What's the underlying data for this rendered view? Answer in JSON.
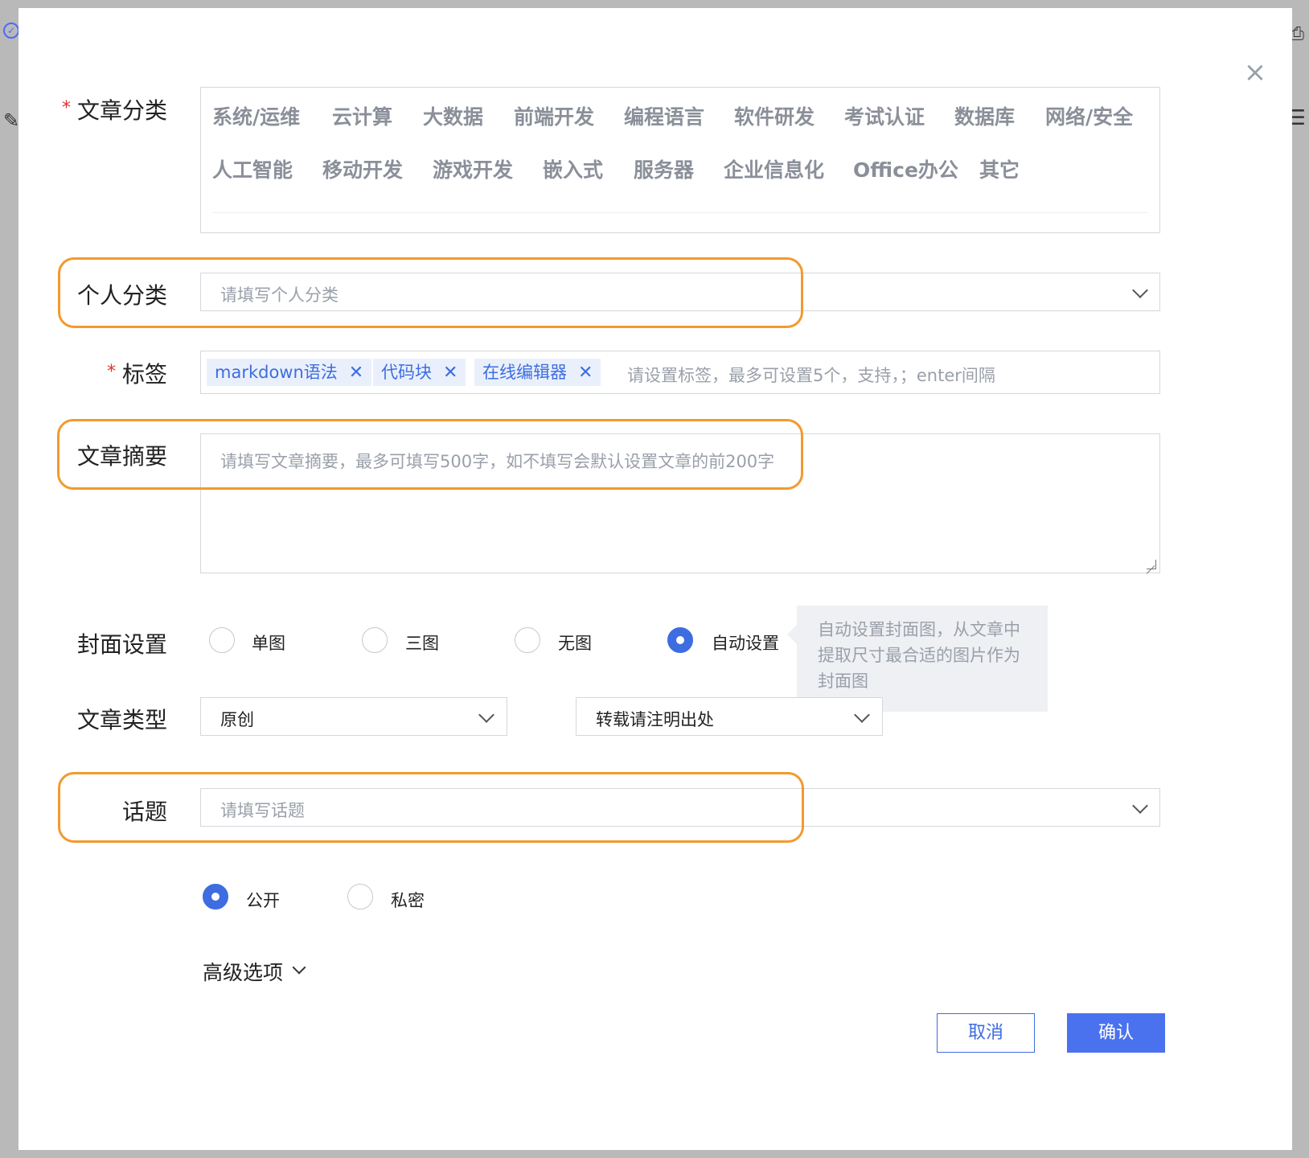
{
  "modal": {
    "close_label": "×"
  },
  "labels": {
    "category": "文章分类",
    "personal_category": "个人分类",
    "tags": "标签",
    "summary": "文章摘要",
    "cover": "封面设置",
    "article_type": "文章类型",
    "topic": "话题"
  },
  "required_mark": "*",
  "categories_row1": [
    "系统/运维",
    "云计算",
    "大数据",
    "前端开发",
    "编程语言",
    "软件研发",
    "考试认证",
    "数据库",
    "网络/安全"
  ],
  "categories_row2": [
    "人工智能",
    "移动开发",
    "游戏开发",
    "嵌入式",
    "服务器",
    "企业信息化",
    "Office办公",
    "其它"
  ],
  "personal_category": {
    "placeholder": "请填写个人分类"
  },
  "tags": {
    "items": [
      "markdown语法",
      "代码块",
      "在线编辑器"
    ],
    "remove_label": "✕",
    "placeholder": "请设置标签，最多可设置5个，支持，；enter间隔"
  },
  "summary": {
    "placeholder": "请填写文章摘要，最多可填写500字，如不填写会默认设置文章的前200字"
  },
  "cover": {
    "options": [
      "单图",
      "三图",
      "无图",
      "自动设置"
    ],
    "selected": "自动设置",
    "tooltip": "自动设置封面图，从文章中提取尺寸最合适的图片作为封面图"
  },
  "article_type": {
    "type_value": "原创",
    "repost_value": "转载请注明出处"
  },
  "topic": {
    "placeholder": "请填写话题"
  },
  "visibility": {
    "options": [
      "公开",
      "私密"
    ],
    "selected": "公开"
  },
  "advanced_label": "高级选项",
  "buttons": {
    "cancel": "取消",
    "confirm": "确认"
  },
  "colors": {
    "accent": "#3d6de0",
    "highlight": "#f29a2e",
    "required": "#e0302a"
  }
}
